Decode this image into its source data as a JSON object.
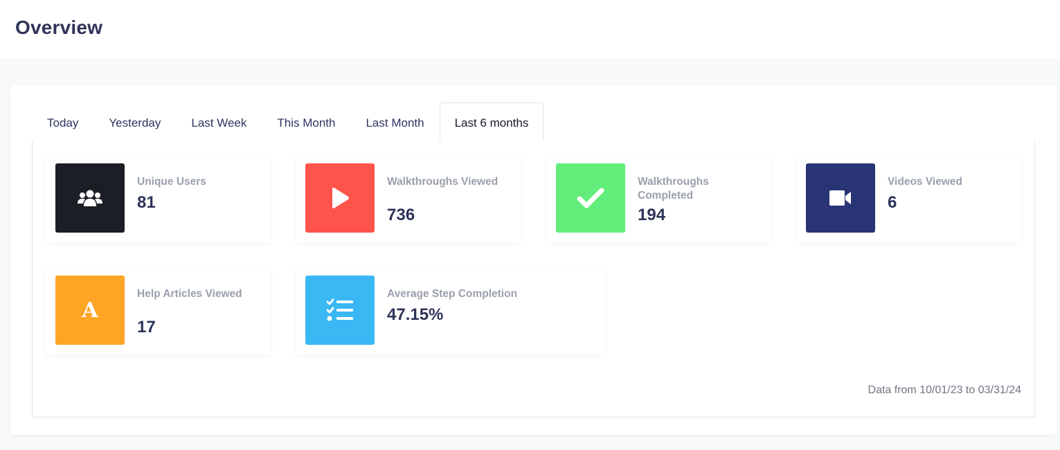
{
  "header": {
    "title": "Overview"
  },
  "tabs": [
    {
      "label": "Today",
      "active": false
    },
    {
      "label": "Yesterday",
      "active": false
    },
    {
      "label": "Last Week",
      "active": false
    },
    {
      "label": "This Month",
      "active": false
    },
    {
      "label": "Last Month",
      "active": false
    },
    {
      "label": "Last 6 months",
      "active": true
    }
  ],
  "stats": [
    {
      "label": "Unique Users",
      "value": "81",
      "icon": "users-icon",
      "color": "#1b1e24"
    },
    {
      "label": "Walkthroughs Viewed",
      "value": "736",
      "icon": "play-icon",
      "color": "#fe544b"
    },
    {
      "label": "Walkthroughs Completed",
      "value": "194",
      "icon": "check-icon",
      "color": "#62ed7a"
    },
    {
      "label": "Videos Viewed",
      "value": "6",
      "icon": "video-camera-icon",
      "color": "#293475"
    },
    {
      "label": "Help Articles Viewed",
      "value": "17",
      "icon": "letter-a-icon",
      "color": "#fea526"
    },
    {
      "label": "Average Step Completion",
      "value": "47.15%",
      "icon": "checklist-icon",
      "color": "#39b8f4"
    }
  ],
  "footer": {
    "date_range": "Data from 10/01/23 to 03/31/24"
  }
}
